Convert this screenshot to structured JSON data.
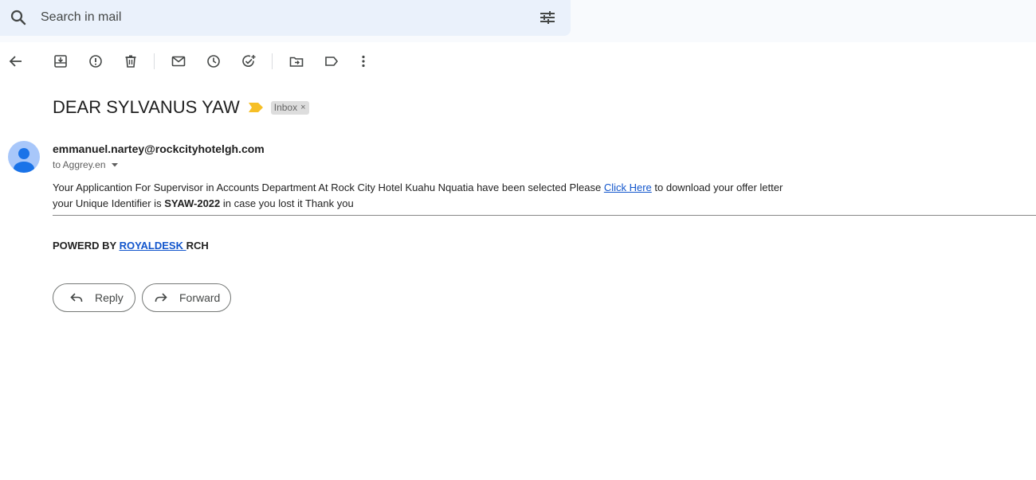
{
  "search": {
    "placeholder": "Search in mail"
  },
  "toolbar": {
    "icons": [
      "back-icon",
      "archive-icon",
      "report-spam-icon",
      "delete-icon",
      "mark-unread-icon",
      "snooze-icon",
      "add-task-icon",
      "move-to-icon",
      "label-icon",
      "more-icon"
    ]
  },
  "message": {
    "subject": "DEAR SYLVANUS YAW",
    "label_chip": "Inbox",
    "label_chip_close": "×",
    "sender": "emmanuel.nartey@rockcityhotelgh.com",
    "recipient": "to Aggrey.en",
    "body": {
      "line1_pre": "Your Applicantion For Supervisor in Accounts Department At Rock City Hotel Kuahu Nquatia have been selected Please ",
      "link": "Click Here",
      "line1_post": " to download your offer letter",
      "line2_pre": "your Unique Identifier is ",
      "identifier": "SYAW-2022",
      "line2_post": " in case you lost it Thank you"
    },
    "powered": {
      "prefix": "POWERD BY ",
      "link": "ROYALDESK ",
      "suffix": "RCH"
    }
  },
  "actions": {
    "reply_label": "Reply",
    "forward_label": "Forward"
  },
  "colors": {
    "link": "#1155cc",
    "importance": "#f6bf26",
    "avatar_bg": "#a8c7fa",
    "avatar_fg": "#1a73e8"
  }
}
